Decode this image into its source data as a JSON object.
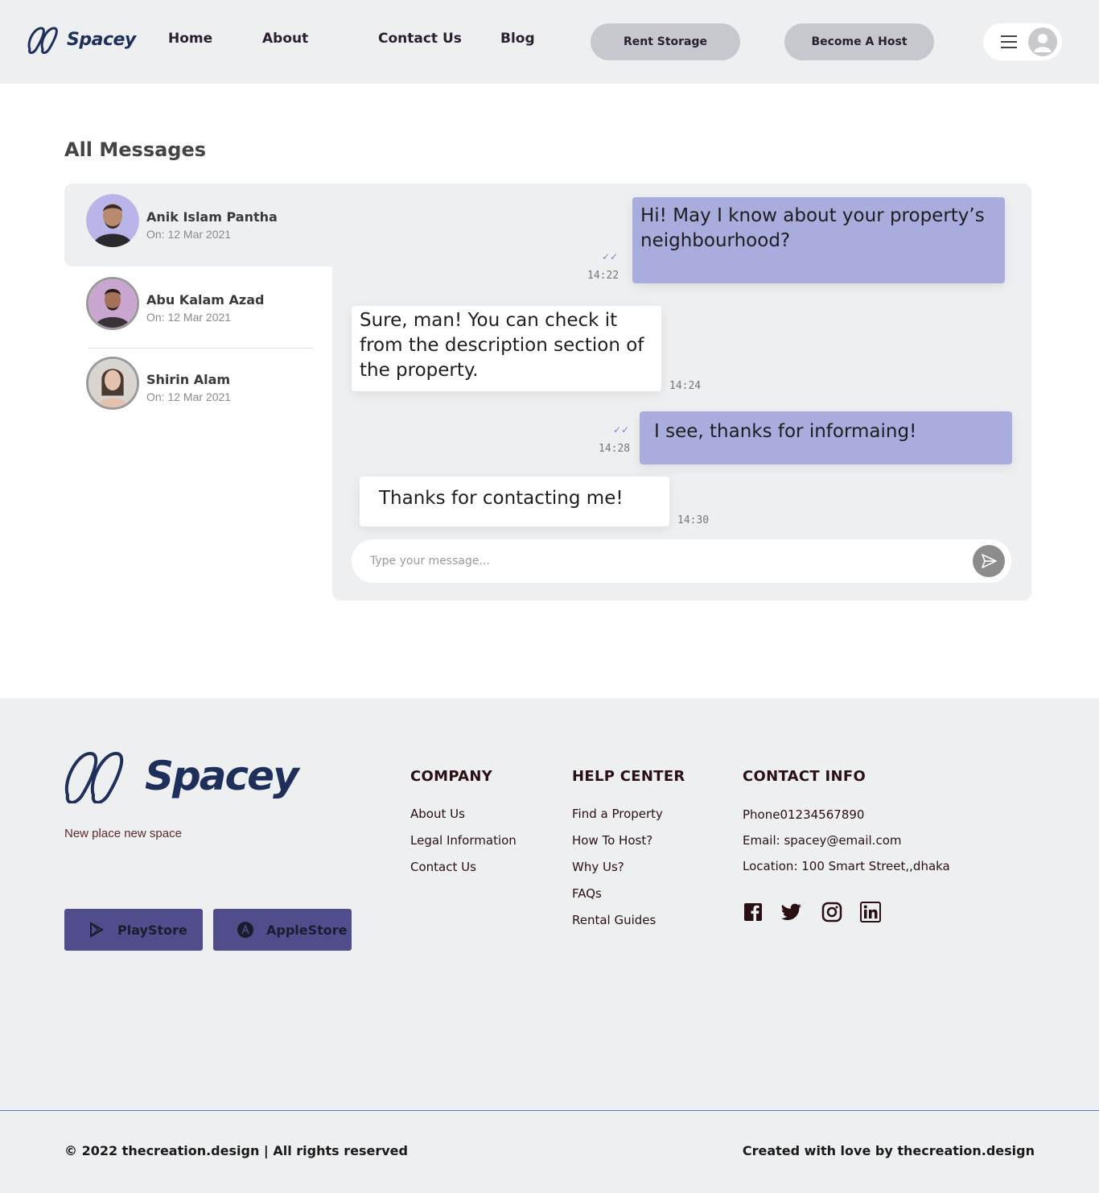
{
  "header": {
    "brand": "Spacey",
    "nav": [
      "Home",
      "About",
      "Contact Us",
      "Blog"
    ],
    "rent_storage": "Rent Storage",
    "become_host": "Become A Host"
  },
  "messages": {
    "title": "All Messages",
    "contacts": [
      {
        "name": "Anik Islam Pantha",
        "date": "On: 12 Mar 2021"
      },
      {
        "name": "Abu Kalam Azad",
        "date": "On: 12 Mar 2021"
      },
      {
        "name": "Shirin Alam",
        "date": "On: 12 Mar 2021"
      }
    ],
    "thread": [
      {
        "text": "Hi! May I know about your property’s neighbourhood?",
        "time": "14:22",
        "direction": "out"
      },
      {
        "text": "Sure, man! You can check it from the description section of the property.",
        "time": "14:24",
        "direction": "in"
      },
      {
        "text": "I see, thanks for informaing!",
        "time": "14:28",
        "direction": "out"
      },
      {
        "text": "Thanks for contacting me!",
        "time": "14:30",
        "direction": "in"
      }
    ],
    "composer_placeholder": "Type your message..."
  },
  "footer": {
    "brand": "Spacey",
    "tagline": "New place new  space",
    "playstore": "PlayStore",
    "applestore": "AppleStore",
    "company": {
      "title": "COMPANY",
      "links": [
        "About Us",
        "Legal Information",
        "Contact Us"
      ]
    },
    "help": {
      "title": "HELP CENTER",
      "links": [
        "Find a Property",
        "How To Host?",
        "Why Us?",
        "FAQs",
        "Rental Guides"
      ]
    },
    "contact": {
      "title": "CONTACT INFO",
      "phone": "Phone01234567890",
      "email": "Email: spacey@email.com",
      "location": "Location: 100 Smart Street,,dhaka"
    },
    "social": [
      "facebook-icon",
      "twitter-icon",
      "instagram-icon",
      "linkedin-icon"
    ],
    "copyright": "© 2022 thecreation.design | All rights reserved",
    "credit": "Created with love by thecreation.design"
  },
  "colors": {
    "brand": "#1e2f5c",
    "outgoing_bubble": "#a9addd",
    "store_button": "#514d8c",
    "panel_bg": "#eeeff1"
  }
}
